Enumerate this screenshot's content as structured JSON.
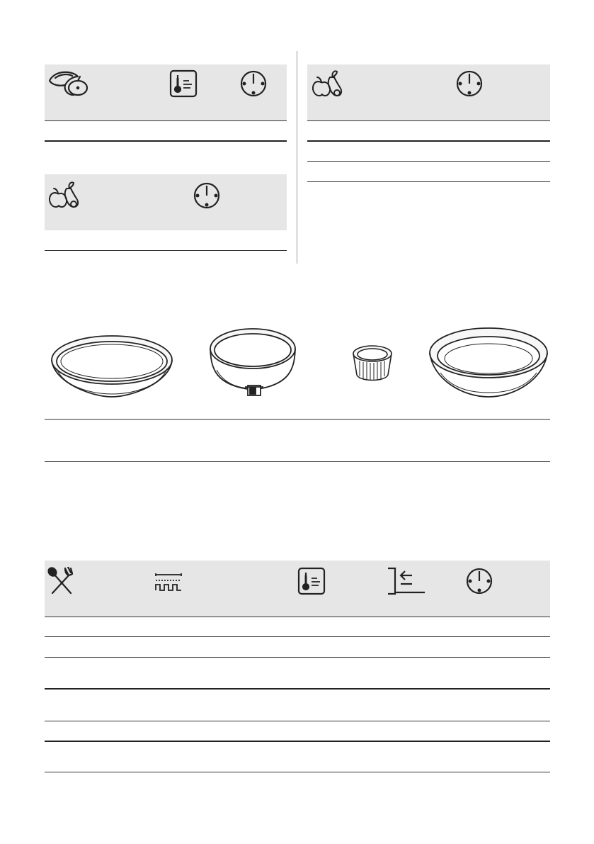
{
  "tables": {
    "table_left_top": {
      "columns": [
        "vegetables-icon",
        "temperature-icon",
        "time-icon"
      ],
      "rows": [
        ""
      ]
    },
    "table_left_bottom": {
      "columns": [
        "fruit-icon",
        "time-icon"
      ],
      "rows": [
        ""
      ]
    },
    "table_right": {
      "columns": [
        "fruit-icon",
        "time-icon"
      ],
      "rows": [
        "",
        "",
        ""
      ]
    },
    "bakeware_row": {
      "items": [
        "flat-baking-tin-icon",
        "springform-tin-icon",
        "ramekin-icon",
        "deep-baking-tin-icon"
      ]
    },
    "table_bottom": {
      "columns": [
        "cutlery-icon",
        "heating-function-icon",
        "temperature-icon",
        "shelf-position-icon",
        "time-icon"
      ],
      "rows": [
        "",
        "",
        "",
        "",
        "",
        "",
        ""
      ]
    }
  },
  "colors": {
    "header_bg": "#e6e6e6",
    "line": "#333333",
    "icon": "#222222"
  }
}
